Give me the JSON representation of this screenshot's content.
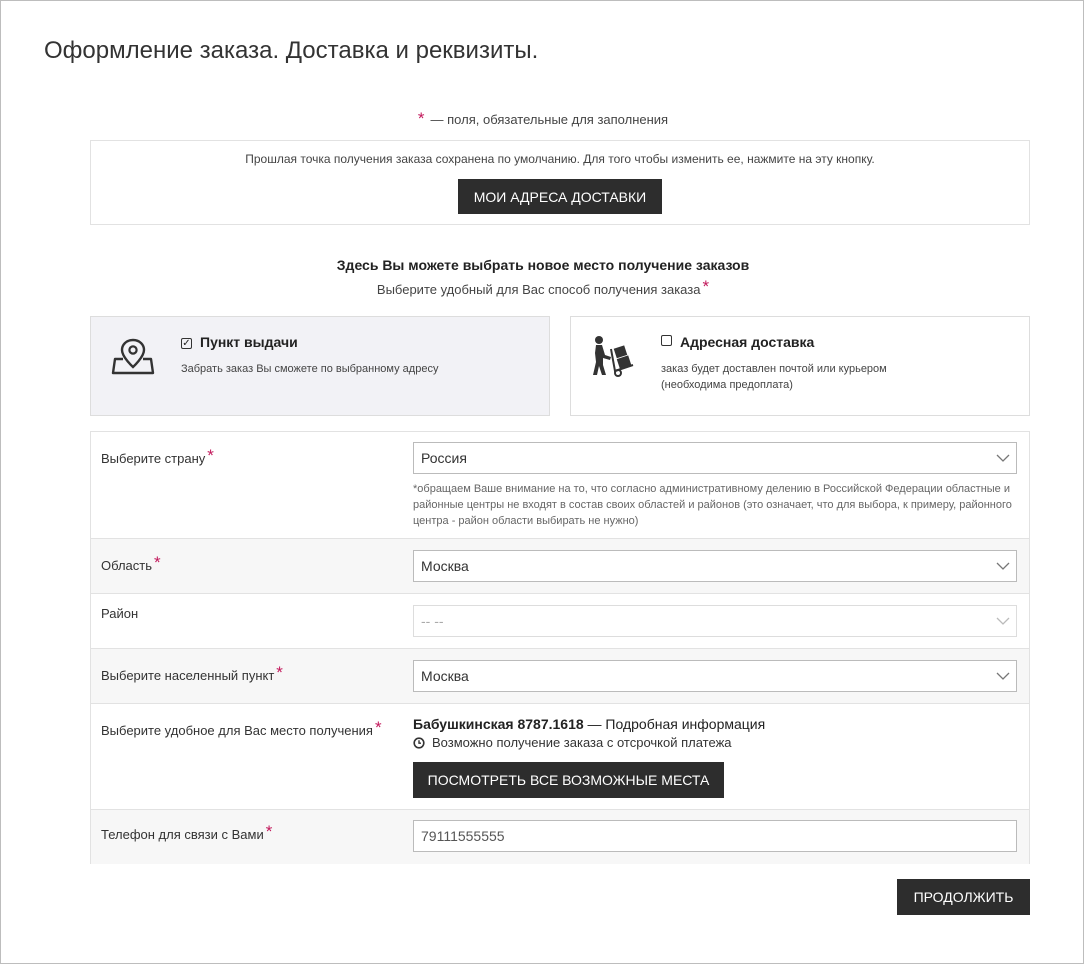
{
  "page": {
    "title": "Оформление заказа. Доставка и реквизиты."
  },
  "required_note": {
    "star": "*",
    "text": "— поля, обязательные для заполнения"
  },
  "saved_point": {
    "text": "Прошлая точка получения заказа сохранена по умолчанию. Для того чтобы изменить ее, нажмите на эту кнопку.",
    "button_label": "МОИ АДРЕСА ДОСТАВКИ"
  },
  "choose": {
    "title": "Здесь Вы можете выбрать новое место получение заказов",
    "subtitle": "Выберите удобный для Вас способ получения заказа"
  },
  "delivery_options": [
    {
      "title": "Пункт выдачи",
      "desc": "Забрать заказ Вы сможете по выбранному адресу",
      "checked": true,
      "icon": "map-pin-icon"
    },
    {
      "title": "Адресная доставка",
      "desc": "заказ будет доставлен почтой или курьером (необходима предоплата)",
      "checked": false,
      "icon": "courier-handtruck-icon"
    }
  ],
  "form": {
    "country": {
      "label": "Выберите страну",
      "value": "Россия",
      "hint": "*обращаем Ваше внимание на то, что согласно административному делению в Российской Федерации областные и районные центры не входят в состав своих областей и районов (это означает, что для выбора, к примеру, районного центра - район области выбирать не нужно)"
    },
    "region": {
      "label": "Область",
      "value": "Москва"
    },
    "district": {
      "label": "Район",
      "value": "-- --"
    },
    "city": {
      "label": "Выберите населенный пункт",
      "value": "Москва"
    },
    "pickup": {
      "label": "Выберите удобное для Вас место получения",
      "place_name": "Бабушкинская 8787.1618",
      "details_link": "— Подробная информация",
      "note": "Возможно получение заказа с отсрочкой платежа",
      "button_label": "ПОСМОТРЕТЬ ВСЕ ВОЗМОЖНЫЕ МЕСТА"
    },
    "phone": {
      "label": "Телефон для связи с Вами",
      "value": "79111555555"
    }
  },
  "continue_button": "ПРОДОЛЖИТЬ",
  "colors": {
    "accent_required": "#c2185b",
    "dark_button": "#2d2d2d"
  }
}
